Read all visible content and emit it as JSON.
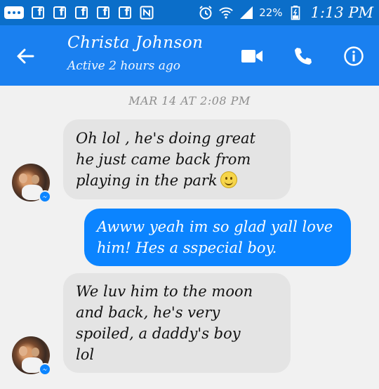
{
  "status_bar": {
    "battery": "22%",
    "time": "1:13 PM",
    "notification_icons": [
      "messenger-icon",
      "facebook-icon",
      "facebook-icon",
      "facebook-icon",
      "facebook-icon",
      "facebook-icon",
      "nfc-icon",
      "alarm-icon",
      "wifi-icon",
      "signal-icon",
      "battery-icon"
    ]
  },
  "header": {
    "contact_name": "Christa Johnson",
    "status": "Active 2 hours ago",
    "actions": [
      "back-arrow-icon",
      "video-call-icon",
      "phone-call-icon",
      "info-icon"
    ]
  },
  "conversation": {
    "date_separator": "MAR 14 AT 2:08 PM",
    "messages": [
      {
        "sender": "contact",
        "text": "Oh lol , he's doing great\nhe just came back from\nplaying in the park",
        "emoji": "slightly-smiling-face"
      },
      {
        "sender": "me",
        "text": "Awww yeah im so glad yall love\nhim! Hes a sspecial boy."
      },
      {
        "sender": "contact",
        "text": "We luv him to the moon\nand back, he's very\nspoiled, a daddy's boy\nlol"
      }
    ]
  },
  "colors": {
    "status_bar": "#0b6ec9",
    "header": "#1a80f0",
    "outgoing_bubble": "#0b84ff",
    "incoming_bubble": "#e4e4e4",
    "background": "#f1f1f1"
  }
}
